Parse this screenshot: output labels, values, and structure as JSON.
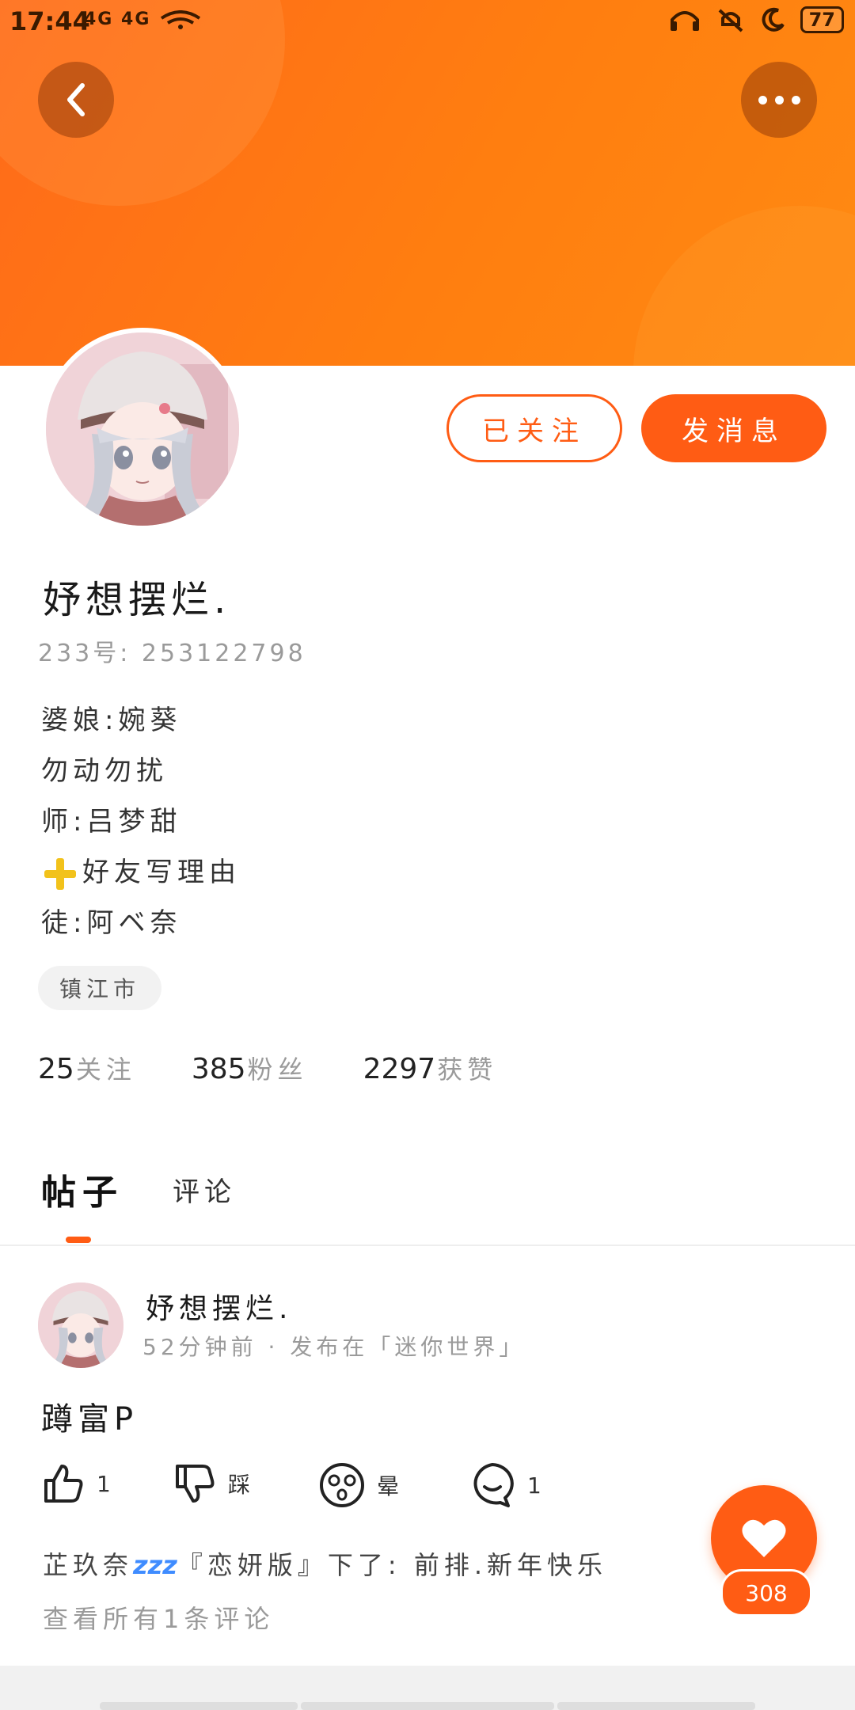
{
  "status_bar": {
    "time": "17:44",
    "network": "4G 4G",
    "right_icons": [
      "headset-icon",
      "vibrate-icon",
      "moon-icon"
    ],
    "battery": "77"
  },
  "header": {
    "back_icon": "chevron-left-icon",
    "more_icon": "more-dots-icon"
  },
  "profile": {
    "follow_label": "已关注",
    "message_label": "发消息",
    "nickname": "妤想摆烂.",
    "uid": "233号: 253122798",
    "bio": [
      "婆娘:婉葵",
      "勿动勿扰",
      "师:吕梦甜",
      "好友写理由",
      "徒:阿ベ奈"
    ],
    "location": "镇江市",
    "stats": [
      {
        "num": "25",
        "label": "关注"
      },
      {
        "num": "385",
        "label": "粉丝"
      },
      {
        "num": "2297",
        "label": "获赞"
      }
    ]
  },
  "tabs": {
    "posts": "帖子",
    "comments": "评论"
  },
  "post": {
    "author": "妤想摆烂.",
    "meta": "52分钟前 · 发布在「迷你世界」",
    "text": "蹲富P",
    "likes": "1",
    "dislike_label": "踩",
    "dizzy_label": "晕",
    "comments": "1",
    "comment_preview_prefix": "芷玖奈",
    "comment_preview_zz": "zzz",
    "comment_preview_suffix": "『恋妍版』下了: 前排.新年快乐",
    "view_all": "查看所有1条评论"
  },
  "like_fab": {
    "count": "308"
  },
  "colors": {
    "accent": "#ff5c14",
    "banner": "#ff7a12"
  }
}
